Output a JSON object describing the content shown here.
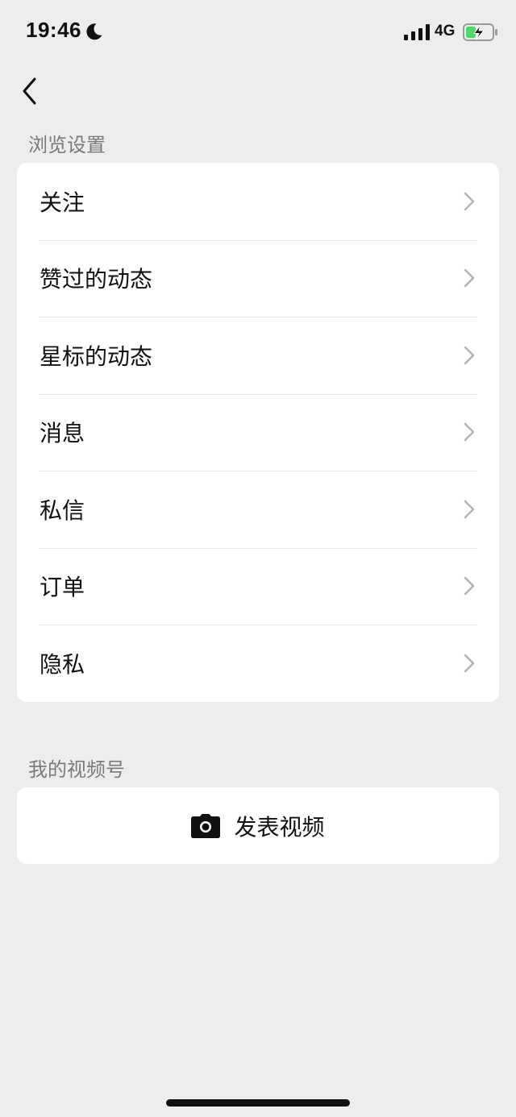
{
  "status_bar": {
    "time": "19:46",
    "network": "4G",
    "icons": [
      "moon-icon",
      "signal-icon",
      "battery-charging-icon"
    ]
  },
  "nav": {
    "back_icon": "chevron-left-icon"
  },
  "browse_section": {
    "label": "浏览设置",
    "items": [
      {
        "label": "关注",
        "icon": "chevron-right-icon"
      },
      {
        "label": "赞过的动态",
        "icon": "chevron-right-icon"
      },
      {
        "label": "星标的动态",
        "icon": "chevron-right-icon"
      },
      {
        "label": "消息",
        "icon": "chevron-right-icon"
      },
      {
        "label": "私信",
        "icon": "chevron-right-icon"
      },
      {
        "label": "订单",
        "icon": "chevron-right-icon"
      },
      {
        "label": "隐私",
        "icon": "chevron-right-icon"
      }
    ]
  },
  "channel_section": {
    "label": "我的视频号",
    "post_button": {
      "label": "发表视频",
      "icon": "camera-icon"
    }
  },
  "colors": {
    "background": "#ededed",
    "card": "#ffffff",
    "section_label": "#7a7a7a",
    "text": "#111111",
    "battery_fill": "#4cd964"
  }
}
